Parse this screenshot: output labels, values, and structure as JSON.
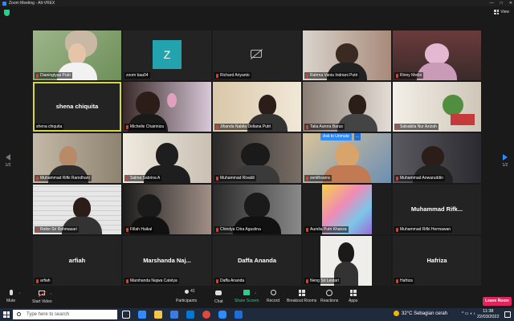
{
  "window": {
    "title": "Zoom Meeting - Alt-VREX",
    "controls": [
      "—",
      "□",
      "✕"
    ]
  },
  "top": {
    "view_label": "View"
  },
  "pager": {
    "prev_label": "1/2",
    "next_label": "1/2"
  },
  "colors": {
    "accent": "#2d8cff",
    "active_speaker": "#d7d742",
    "leave": "#e0245e",
    "share": "#23d18b",
    "muted": "#e53935"
  },
  "tiles": [
    {
      "name": "Dianingtyas Putri"
    },
    {
      "name": "zoom baa04",
      "avatar_letter": "Z"
    },
    {
      "name": "Richard Ariyanto"
    },
    {
      "name": "Rahma Vania Indriani Putri"
    },
    {
      "name": "Rinny Meilin"
    },
    {
      "name": "shena chiquita",
      "display": "shena chiquita"
    },
    {
      "name": "Michelle Chairiniza"
    },
    {
      "name": "Jihanda Nabila Deliana Putri"
    },
    {
      "name": "Talia Aurora Barus"
    },
    {
      "name": "Salsabila Nur Azizah"
    },
    {
      "name": "Muhammad Rifki Ramdhani"
    },
    {
      "name": "Salma Sabrina A"
    },
    {
      "name": "Muhammad Rivaldi"
    },
    {
      "name": "zenithsarra"
    },
    {
      "name": "Muhammad Anwaruddin"
    },
    {
      "name": "Reiko Sri Rahmasari"
    },
    {
      "name": "Fillah Haikal"
    },
    {
      "name": "Chindya Citra Agustina"
    },
    {
      "name": "Aurelia Putri Khanza"
    },
    {
      "name": "Muhammad Rifki Hermawan",
      "display": "Muhammad Rifk..."
    },
    {
      "name": "arfiah",
      "display": "arfiah"
    },
    {
      "name": "Marshanda Najwa Catelya",
      "display": "Marshanda Naj..."
    },
    {
      "name": "Daffa Ananda",
      "display": "Daffa Ananda"
    },
    {
      "name": "Neng Sri Lestari"
    },
    {
      "name": "Hafriza",
      "display": "Hafriza"
    }
  ],
  "ask_to_unmute": {
    "label": "Ask to Unmute",
    "more": "..."
  },
  "toolbar": {
    "mute": "Mute",
    "start_video": "Start Video",
    "participants": "Participants",
    "participants_count": "41",
    "chat": "Chat",
    "share_screen": "Share Screen",
    "record": "Record",
    "breakout": "Breakout Rooms",
    "reactions": "Reactions",
    "apps": "Apps",
    "leave": "Leave Room"
  },
  "taskbar": {
    "search_placeholder": "Type here to search",
    "weather": "32°C  Sebagian cerah",
    "time": "11:38",
    "date": "22/03/2022"
  }
}
